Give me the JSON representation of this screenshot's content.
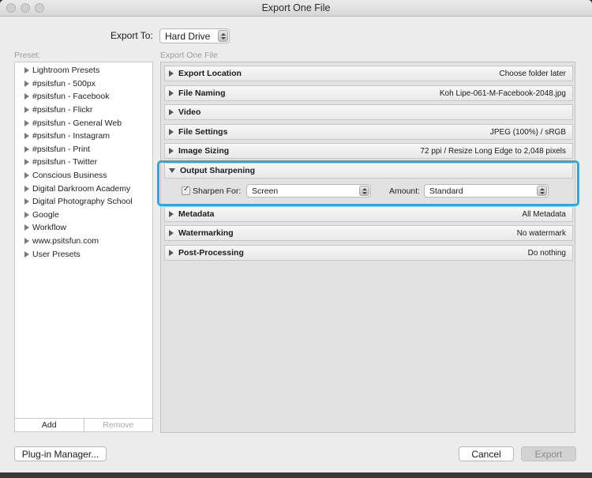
{
  "window": {
    "title": "Export One File"
  },
  "export_to": {
    "label": "Export To:",
    "value": "Hard Drive"
  },
  "preset": {
    "caption": "Preset:",
    "items": [
      "Lightroom Presets",
      "#psitsfun - 500px",
      "#psitsfun - Facebook",
      "#psitsfun - Flickr",
      "#psitsfun - General Web",
      "#psitsfun - Instagram",
      "#psitsfun - Print",
      "#psitsfun - Twitter",
      "Conscious Business",
      "Digital Darkroom Academy",
      "Digital Photography School",
      "Google",
      "Workflow",
      "www.psitsfun.com",
      "User Presets"
    ],
    "add_label": "Add",
    "remove_label": "Remove"
  },
  "sections": {
    "caption": "Export One File",
    "items": [
      {
        "title": "Export Location",
        "summary": "Choose folder later",
        "expanded": false
      },
      {
        "title": "File Naming",
        "summary": "Koh Lipe-061-M-Facebook-2048.jpg",
        "expanded": false
      },
      {
        "title": "Video",
        "summary": "",
        "expanded": false
      },
      {
        "title": "File Settings",
        "summary": "JPEG (100%) / sRGB",
        "expanded": false
      },
      {
        "title": "Image Sizing",
        "summary": "72 ppi / Resize Long Edge to 2,048 pixels",
        "expanded": false
      },
      {
        "title": "Output Sharpening",
        "summary": "",
        "expanded": true
      },
      {
        "title": "Metadata",
        "summary": "All Metadata",
        "expanded": false
      },
      {
        "title": "Watermarking",
        "summary": "No watermark",
        "expanded": false
      },
      {
        "title": "Post-Processing",
        "summary": "Do nothing",
        "expanded": false
      }
    ],
    "sharpening": {
      "sharpen_for_label": "Sharpen For:",
      "sharpen_for_value": "Screen",
      "sharpen_checked": true,
      "amount_label": "Amount:",
      "amount_value": "Standard"
    }
  },
  "buttons": {
    "plugin_manager": "Plug-in Manager...",
    "cancel": "Cancel",
    "export": "Export"
  },
  "colors": {
    "highlight": "#2aa8e6"
  }
}
